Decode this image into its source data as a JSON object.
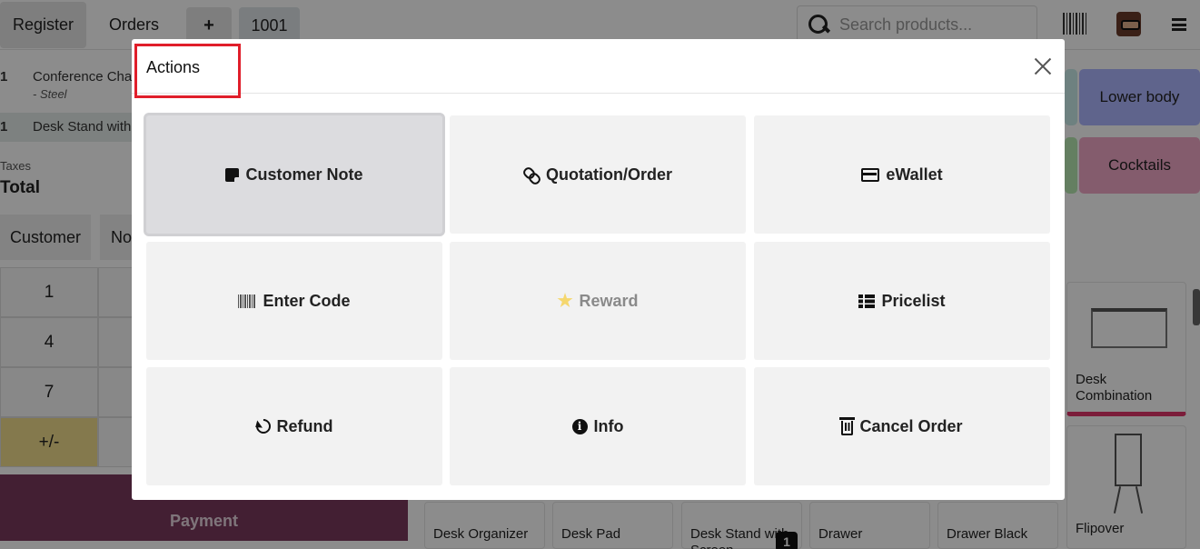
{
  "topbar": {
    "register_label": "Register",
    "orders_label": "Orders",
    "new_order_label": "+",
    "order_number": "1001",
    "search_placeholder": "Search products..."
  },
  "order": {
    "lines": [
      {
        "qty": "1",
        "name": "Conference Chai",
        "variant": "- Steel"
      },
      {
        "qty": "1",
        "name": "Desk Stand with"
      }
    ],
    "taxes_label": "Taxes",
    "total_label": "Total"
  },
  "controls": {
    "customer_label": "Customer",
    "note_label": "No",
    "numpad": [
      "1",
      "4",
      "7",
      "+/-"
    ],
    "payment_label": "Payment"
  },
  "categories": [
    {
      "label": "Lower body",
      "color": "#aeb6ff"
    },
    {
      "label": "Cocktails",
      "color": "#f0a8c7"
    }
  ],
  "products": {
    "side": [
      {
        "name": "Desk Combination"
      },
      {
        "name": "Flipover"
      }
    ],
    "bottom": [
      {
        "name": "Desk Organizer"
      },
      {
        "name": "Desk Pad"
      },
      {
        "name": "Desk Stand with Screen",
        "badge": "1"
      },
      {
        "name": "Drawer"
      },
      {
        "name": "Drawer Black"
      }
    ]
  },
  "modal": {
    "title": "Actions",
    "highlight_color": "#e01e2a",
    "actions": [
      {
        "label": "Customer Note",
        "icon": "sticky-note-icon"
      },
      {
        "label": "Quotation/Order",
        "icon": "link-icon"
      },
      {
        "label": "eWallet",
        "icon": "credit-card-icon"
      },
      {
        "label": "Enter Code",
        "icon": "barcode-icon"
      },
      {
        "label": "Reward",
        "icon": "star-icon"
      },
      {
        "label": "Pricelist",
        "icon": "list-icon"
      },
      {
        "label": "Refund",
        "icon": "undo-icon"
      },
      {
        "label": "Info",
        "icon": "info-icon"
      },
      {
        "label": "Cancel Order",
        "icon": "trash-icon"
      }
    ]
  }
}
